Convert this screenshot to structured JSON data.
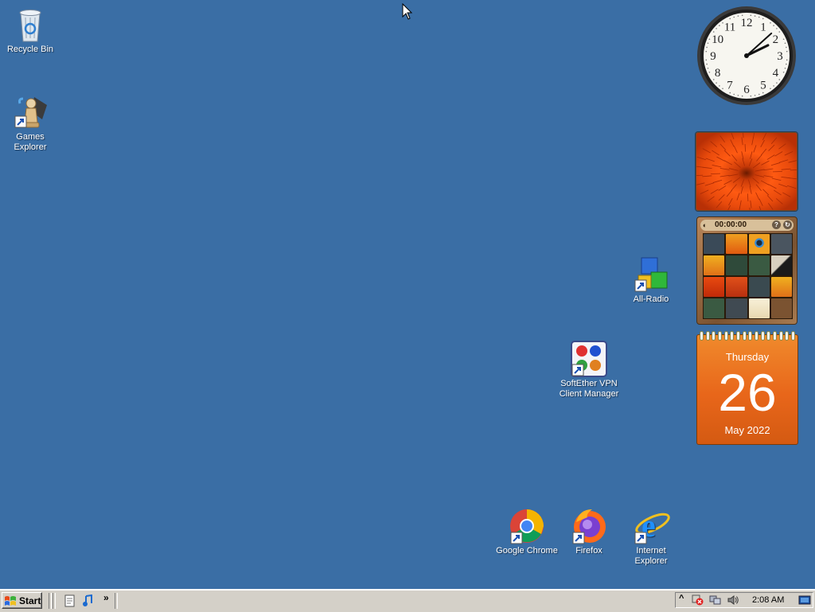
{
  "desktop_icons": {
    "recycle_bin": "Recycle Bin",
    "games_explorer_line1": "Games",
    "games_explorer_line2": "Explorer",
    "all_radio": "All-Radio",
    "softether_line1": "SoftEther VPN",
    "softether_line2": "Client Manager",
    "google_chrome": "Google Chrome",
    "firefox": "Firefox",
    "ie_line1": "Internet",
    "ie_line2": "Explorer"
  },
  "gadgets": {
    "clock": {
      "hour_numbers": [
        "12",
        "1",
        "2",
        "3",
        "4",
        "5",
        "6",
        "7",
        "8",
        "9",
        "10",
        "11"
      ],
      "time_shown": "2:08"
    },
    "puzzle": {
      "timer": "00:00:00",
      "help_icon": "help-icon",
      "shuffle_icon": "shuffle-icon"
    },
    "calendar": {
      "weekday": "Thursday",
      "day": "26",
      "month_year": "May 2022"
    }
  },
  "taskbar": {
    "start_label": "Start",
    "quicklaunch_more": "»",
    "tray_expand": "^",
    "clock": "2:08 AM"
  },
  "colors": {
    "desktop": "#3a6ea5",
    "taskbar": "#d4d0c8",
    "calendar": "#e8661a"
  }
}
